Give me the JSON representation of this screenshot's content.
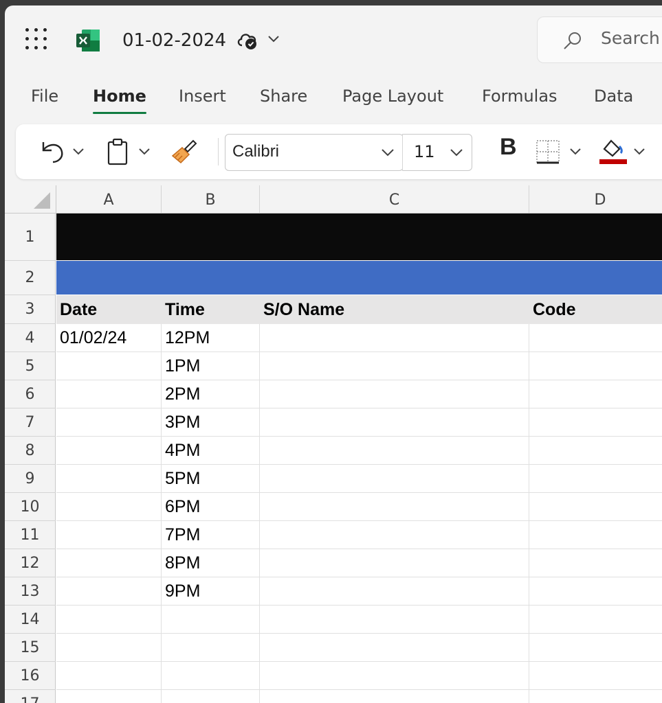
{
  "app": {
    "document_title": "01-02-2024",
    "search_placeholder": "Search"
  },
  "menu": {
    "tabs": [
      {
        "label": "File"
      },
      {
        "label": "Home",
        "active": true
      },
      {
        "label": "Insert"
      },
      {
        "label": "Share"
      },
      {
        "label": "Page Layout"
      },
      {
        "label": "Formulas"
      },
      {
        "label": "Data"
      }
    ]
  },
  "ribbon": {
    "font_name": "Calibri",
    "font_size": "11",
    "bold_label": "B",
    "fill_color": "#c00000",
    "icons": [
      "undo-icon",
      "paste-icon",
      "format-painter-icon",
      "borders-icon",
      "fill-color-icon"
    ]
  },
  "sheet": {
    "columns": [
      "A",
      "B",
      "C",
      "D"
    ],
    "row_numbers": [
      "1",
      "2",
      "3",
      "4",
      "5",
      "6",
      "7",
      "8",
      "9",
      "10",
      "11",
      "12",
      "13",
      "14",
      "15",
      "16",
      "17"
    ],
    "header_row": [
      "Date",
      "Time",
      "S/O Name",
      "Code"
    ],
    "rows": [
      [
        "01/02/24",
        "12PM",
        "",
        ""
      ],
      [
        "",
        "1PM",
        "",
        ""
      ],
      [
        "",
        "2PM",
        "",
        ""
      ],
      [
        "",
        "3PM",
        "",
        ""
      ],
      [
        "",
        "4PM",
        "",
        ""
      ],
      [
        "",
        "5PM",
        "",
        ""
      ],
      [
        "",
        "6PM",
        "",
        ""
      ],
      [
        "",
        "7PM",
        "",
        ""
      ],
      [
        "",
        "8PM",
        "",
        ""
      ],
      [
        "",
        "9PM",
        "",
        ""
      ],
      [
        "",
        "",
        "",
        ""
      ],
      [
        "",
        "",
        "",
        ""
      ],
      [
        "",
        "",
        "",
        ""
      ],
      [
        "",
        "",
        "",
        ""
      ]
    ],
    "colors": {
      "row1_fill": "#0b0b0b",
      "row2_fill": "#3f6cc4",
      "header_fill": "#e7e6e6",
      "accent": "#107c41"
    }
  }
}
